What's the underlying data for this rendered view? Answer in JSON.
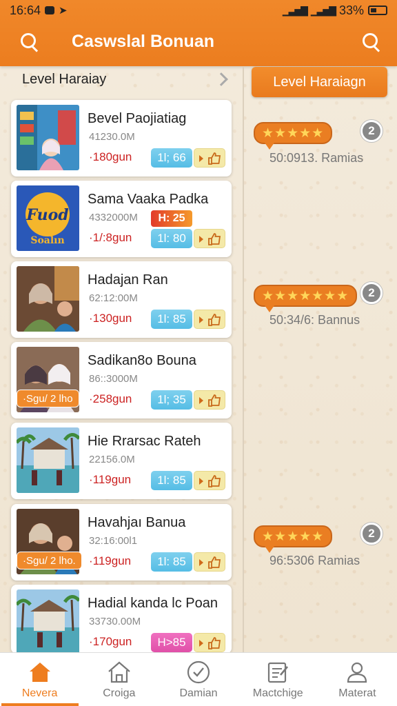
{
  "status_bar": {
    "time": "16:64",
    "battery": "33%"
  },
  "app_bar": {
    "title": "Caswslal Bonuan"
  },
  "section": {
    "title": "Level Haraiay"
  },
  "right_panel": {
    "level_button": "Level Haraiagn",
    "ratings": [
      {
        "stars": "★★★★★",
        "count": "2",
        "text": "50:0913. Ramias"
      },
      {
        "stars": "★★★★★★★",
        "count": "2",
        "text": "50:34/6: Bannus"
      },
      {
        "stars": "★★★★★",
        "count": "2",
        "text": "96:5306 Ramias"
      }
    ]
  },
  "items": [
    {
      "name": "Bevel Paojiatiag",
      "code": "41230.0M",
      "price": "·180gun",
      "badge": "1l; 66",
      "hot": "",
      "tag": ""
    },
    {
      "name": "Sama Vaaka Padka",
      "code": "4332000M",
      "price": "·1/:8gun",
      "badge": "1l: 80",
      "hot": "H: 25",
      "tag": ""
    },
    {
      "name": "Hadajan Ran",
      "code": "62:12:00M",
      "price": "·130gun",
      "badge": "1l: 85",
      "hot": "",
      "tag": ""
    },
    {
      "name": "Sadikan8o Bouna",
      "code": "86::3000M",
      "price": "·258gun",
      "badge": "1l; 35",
      "hot": "",
      "tag": "·Sgu/ 2 lho"
    },
    {
      "name": "Hie Rrarsac Rateh",
      "code": "22156.0M",
      "price": "·119gun",
      "badge": "1l: 85",
      "hot": "",
      "tag": ""
    },
    {
      "name": "Havahjaı Banua",
      "code": "32:16:00l1",
      "price": "·119gun",
      "badge": "1l: 85",
      "hot": "",
      "tag": "·Sgu/ 2 lho."
    },
    {
      "name": "Hadial kanda lc Poan",
      "code": "33730.00M",
      "price": "·170gun",
      "badge": "H>85",
      "hot": "",
      "tag": ""
    }
  ],
  "bottom_nav": [
    {
      "label": "Nevera",
      "icon": "home-icon"
    },
    {
      "label": "Croiga",
      "icon": "house-outline-icon"
    },
    {
      "label": "Damian",
      "icon": "check-circle-icon"
    },
    {
      "label": "Mactchige",
      "icon": "checklist-icon"
    },
    {
      "label": "Materat",
      "icon": "person-icon"
    }
  ],
  "colors": {
    "accent": "#ee7d1f",
    "price": "#cc2222",
    "badge_blue": "#55bde5"
  }
}
